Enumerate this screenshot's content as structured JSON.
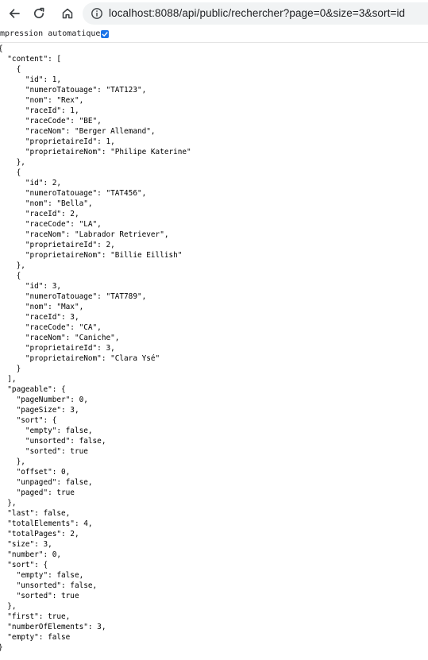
{
  "browser": {
    "url": "localhost:8088/api/public/rechercher?page=0&size=3&sort=id",
    "icons": [
      "back-icon",
      "reload-icon",
      "home-icon",
      "info-icon"
    ]
  },
  "pretty_print": {
    "label": "Impression automatique",
    "checked": true
  },
  "json_body": "{\n  \"content\": [\n    {\n      \"id\": 1,\n      \"numeroTatouage\": \"TAT123\",\n      \"nom\": \"Rex\",\n      \"raceId\": 1,\n      \"raceCode\": \"BE\",\n      \"raceNom\": \"Berger Allemand\",\n      \"proprietaireId\": 1,\n      \"proprietaireNom\": \"Philipe Katerine\"\n    },\n    {\n      \"id\": 2,\n      \"numeroTatouage\": \"TAT456\",\n      \"nom\": \"Bella\",\n      \"raceId\": 2,\n      \"raceCode\": \"LA\",\n      \"raceNom\": \"Labrador Retriever\",\n      \"proprietaireId\": 2,\n      \"proprietaireNom\": \"Billie Eillish\"\n    },\n    {\n      \"id\": 3,\n      \"numeroTatouage\": \"TAT789\",\n      \"nom\": \"Max\",\n      \"raceId\": 3,\n      \"raceCode\": \"CA\",\n      \"raceNom\": \"Caniche\",\n      \"proprietaireId\": 3,\n      \"proprietaireNom\": \"Clara Ysé\"\n    }\n  ],\n  \"pageable\": {\n    \"pageNumber\": 0,\n    \"pageSize\": 3,\n    \"sort\": {\n      \"empty\": false,\n      \"unsorted\": false,\n      \"sorted\": true\n    },\n    \"offset\": 0,\n    \"unpaged\": false,\n    \"paged\": true\n  },\n  \"last\": false,\n  \"totalElements\": 4,\n  \"totalPages\": 2,\n  \"size\": 3,\n  \"number\": 0,\n  \"sort\": {\n    \"empty\": false,\n    \"unsorted\": false,\n    \"sorted\": true\n  },\n  \"first\": true,\n  \"numberOfElements\": 3,\n  \"empty\": false\n}"
}
